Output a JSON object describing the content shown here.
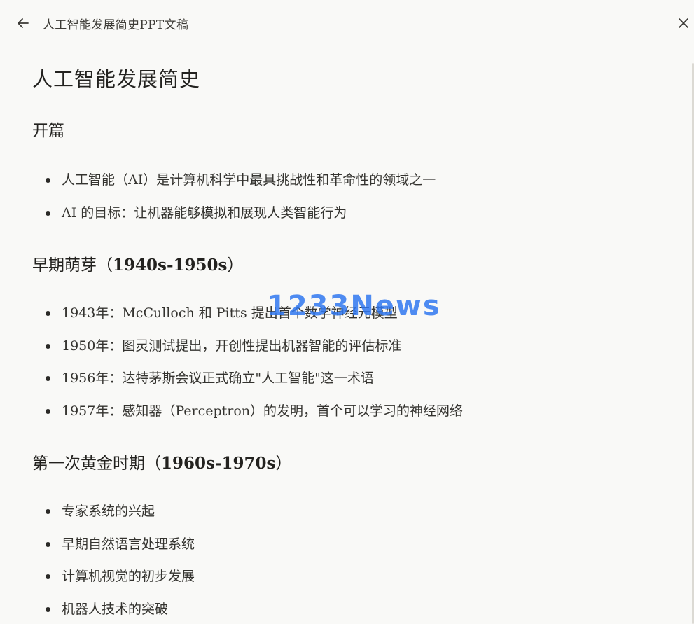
{
  "header": {
    "title": "人工智能发展简史PPT文稿",
    "back_icon": "arrow-left-icon",
    "close_icon": "close-icon"
  },
  "document": {
    "title": "人工智能发展简史",
    "sections": [
      {
        "heading": "开篇",
        "items": [
          "人工智能（AI）是计算机科学中最具挑战性和革命性的领域之一",
          "AI 的目标：让机器能够模拟和展现人类智能行为"
        ]
      },
      {
        "heading": "早期萌芽（",
        "heading_bold": "1940s-1950s",
        "heading_end": "）",
        "items": [
          "1943年：McCulloch 和 Pitts 提出首个数学神经元模型",
          "1950年：图灵测试提出，开创性提出机器智能的评估标准",
          "1956年：达特茅斯会议正式确立\"人工智能\"这一术语",
          "1957年：感知器（Perceptron）的发明，首个可以学习的神经网络"
        ]
      },
      {
        "heading": "第一次黄金时期（",
        "heading_bold": "1960s-1970s",
        "heading_end": "）",
        "items": [
          "专家系统的兴起",
          "早期自然语言处理系统",
          "计算机视觉的初步发展",
          "机器人技术的突破"
        ]
      }
    ]
  },
  "watermark": "1233News",
  "colors": {
    "background": "#f9f9f7",
    "text": "#2b2a27",
    "watermark": "#3078f0"
  }
}
